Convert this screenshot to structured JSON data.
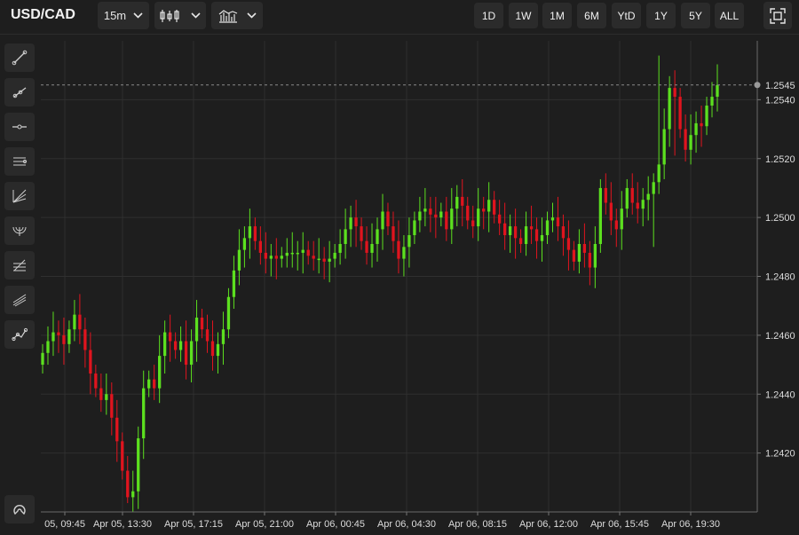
{
  "header": {
    "symbol": "USD/CAD",
    "interval": "15m",
    "chart_type_icon": "candlestick-icon",
    "indicators_icon": "indicators-icon",
    "ranges": [
      "1D",
      "1W",
      "1M",
      "6M",
      "YtD",
      "1Y",
      "5Y",
      "ALL"
    ],
    "fullscreen_icon": "fullscreen-icon"
  },
  "tools": [
    "trend-line-icon",
    "ray-icon",
    "horizontal-line-icon",
    "parallel-channel-icon",
    "fib-fan-icon",
    "fib-arc-icon",
    "fib-retracement-icon",
    "pitchfork-icon",
    "path-icon"
  ],
  "magnet_icon": "magnet-icon",
  "colors": {
    "up": "#5ce01f",
    "down": "#e0141e",
    "background": "#1e1e1e",
    "grid": "#2f2f2f"
  },
  "chart_data": {
    "type": "candlestick",
    "title": "",
    "ylim": [
      1.24,
      1.256
    ],
    "yticks": [
      "1.2420",
      "1.2440",
      "1.2460",
      "1.2480",
      "1.2500",
      "1.2520",
      "1.2540"
    ],
    "last_price": "1.2545",
    "xticks": [
      "05, 09:45",
      "Apr 05, 13:30",
      "Apr 05, 17:15",
      "Apr 05, 21:00",
      "Apr 06, 00:45",
      "Apr 06, 04:30",
      "Apr 06, 08:15",
      "Apr 06, 12:00",
      "Apr 06, 15:45",
      "Apr 06, 19:30"
    ],
    "closes": [
      1.2454,
      1.2458,
      1.2461,
      1.246,
      1.2457,
      1.2462,
      1.2467,
      1.2462,
      1.2455,
      1.2447,
      1.2442,
      1.2438,
      1.244,
      1.2432,
      1.2424,
      1.2414,
      1.2405,
      1.2407,
      1.2425,
      1.2442,
      1.2445,
      1.2442,
      1.2453,
      1.2461,
      1.2458,
      1.2455,
      1.2458,
      1.245,
      1.2458,
      1.2466,
      1.2462,
      1.2458,
      1.2453,
      1.2457,
      1.2462,
      1.2473,
      1.2482,
      1.2489,
      1.2493,
      1.2497,
      1.2492,
      1.2488,
      1.2486,
      1.2487,
      1.2486,
      1.2487,
      1.2488,
      1.2488,
      1.2488,
      1.2489,
      1.2487,
      1.2486,
      1.2486,
      1.2485,
      1.2486,
      1.2488,
      1.2491,
      1.2496,
      1.25,
      1.2497,
      1.2492,
      1.2488,
      1.2491,
      1.2496,
      1.2502,
      1.2497,
      1.2492,
      1.2486,
      1.249,
      1.2494,
      1.2499,
      1.2502,
      1.2503,
      1.2501,
      1.25,
      1.2502,
      1.2496,
      1.2503,
      1.2507,
      1.2504,
      1.2499,
      1.2497,
      1.2503,
      1.2502,
      1.2506,
      1.2501,
      1.2498,
      1.2494,
      1.2497,
      1.2493,
      1.2491,
      1.2497,
      1.2496,
      1.2492,
      1.2494,
      1.2499,
      1.25,
      1.2497,
      1.2493,
      1.2489,
      1.2485,
      1.2491,
      1.2488,
      1.2483,
      1.2491,
      1.251,
      1.2505,
      1.2499,
      1.2496,
      1.2503,
      1.251,
      1.2505,
      1.2503,
      1.2506,
      1.2508,
      1.2512,
      1.2518,
      1.253,
      1.2544,
      1.2541,
      1.253,
      1.2523,
      1.2528,
      1.2532,
      1.2531,
      1.2538,
      1.2541,
      1.2545
    ]
  }
}
